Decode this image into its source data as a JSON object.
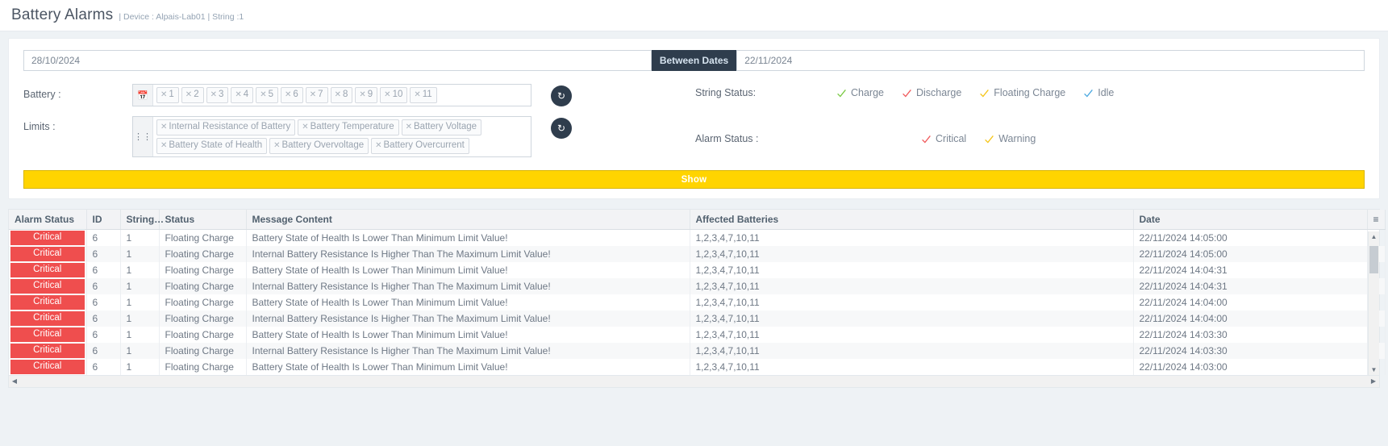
{
  "header": {
    "title": "Battery Alarms",
    "subtitle": "| Device : Alpais-Lab01  | String :1"
  },
  "filters": {
    "start_date": "28/10/2024",
    "between_label": "Between Dates",
    "end_date": "22/11/2024",
    "battery_label": "Battery :",
    "battery_icon": "calendar-icon",
    "battery_chips": [
      "1",
      "2",
      "3",
      "4",
      "5",
      "6",
      "7",
      "8",
      "9",
      "10",
      "11"
    ],
    "limits_label": "Limits :",
    "limits_icon": "sliders-icon",
    "limit_chips": [
      "Internal Resistance of Battery",
      "Battery Temperature",
      "Battery Voltage",
      "Battery State of Health",
      "Battery Overvoltage",
      "Battery Overcurrent"
    ],
    "refresh_icon": "refresh-icon",
    "string_status_label": "String Status:",
    "string_status_options": [
      {
        "label": "Charge",
        "color": "#7ac943"
      },
      {
        "label": "Discharge",
        "color": "#f0595b"
      },
      {
        "label": "Floating Charge",
        "color": "#f5c518"
      },
      {
        "label": "Idle",
        "color": "#4aa8e0"
      }
    ],
    "alarm_status_label": "Alarm Status :",
    "alarm_status_options": [
      {
        "label": "Critical",
        "color": "#f0595b"
      },
      {
        "label": "Warning",
        "color": "#f5c518"
      }
    ],
    "show_label": "Show",
    "show_color": "#ffd400"
  },
  "table": {
    "columns": [
      "Alarm Status",
      "ID",
      "String…",
      "Status",
      "Message Content",
      "Affected Batteries",
      "Date"
    ],
    "menu_icon": "list-menu-icon",
    "rows": [
      {
        "alarm": "Critical",
        "id": "6",
        "string": "1",
        "status": "Floating Charge",
        "message": "Battery State of Health Is Lower Than Minimum Limit Value!",
        "batteries": "1,2,3,4,7,10,11",
        "date": "22/11/2024 14:05:00"
      },
      {
        "alarm": "Critical",
        "id": "6",
        "string": "1",
        "status": "Floating Charge",
        "message": "Internal Battery Resistance Is Higher Than The Maximum Limit Value!",
        "batteries": "1,2,3,4,7,10,11",
        "date": "22/11/2024 14:05:00"
      },
      {
        "alarm": "Critical",
        "id": "6",
        "string": "1",
        "status": "Floating Charge",
        "message": "Battery State of Health Is Lower Than Minimum Limit Value!",
        "batteries": "1,2,3,4,7,10,11",
        "date": "22/11/2024 14:04:31"
      },
      {
        "alarm": "Critical",
        "id": "6",
        "string": "1",
        "status": "Floating Charge",
        "message": "Internal Battery Resistance Is Higher Than The Maximum Limit Value!",
        "batteries": "1,2,3,4,7,10,11",
        "date": "22/11/2024 14:04:31"
      },
      {
        "alarm": "Critical",
        "id": "6",
        "string": "1",
        "status": "Floating Charge",
        "message": "Battery State of Health Is Lower Than Minimum Limit Value!",
        "batteries": "1,2,3,4,7,10,11",
        "date": "22/11/2024 14:04:00"
      },
      {
        "alarm": "Critical",
        "id": "6",
        "string": "1",
        "status": "Floating Charge",
        "message": "Internal Battery Resistance Is Higher Than The Maximum Limit Value!",
        "batteries": "1,2,3,4,7,10,11",
        "date": "22/11/2024 14:04:00"
      },
      {
        "alarm": "Critical",
        "id": "6",
        "string": "1",
        "status": "Floating Charge",
        "message": "Battery State of Health Is Lower Than Minimum Limit Value!",
        "batteries": "1,2,3,4,7,10,11",
        "date": "22/11/2024 14:03:30"
      },
      {
        "alarm": "Critical",
        "id": "6",
        "string": "1",
        "status": "Floating Charge",
        "message": "Internal Battery Resistance Is Higher Than The Maximum Limit Value!",
        "batteries": "1,2,3,4,7,10,11",
        "date": "22/11/2024 14:03:30"
      },
      {
        "alarm": "Critical",
        "id": "6",
        "string": "1",
        "status": "Floating Charge",
        "message": "Battery State of Health Is Lower Than Minimum Limit Value!",
        "batteries": "1,2,3,4,7,10,11",
        "date": "22/11/2024 14:03:00"
      }
    ]
  }
}
